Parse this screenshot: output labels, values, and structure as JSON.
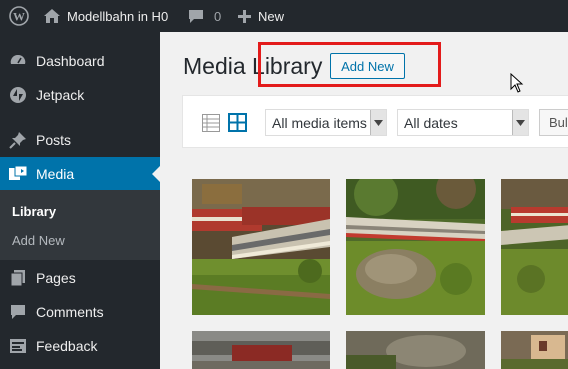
{
  "adminbar": {
    "site_name": "Modellbahn in H0",
    "comments_count": "0",
    "new_label": "New"
  },
  "sidebar": {
    "items": [
      {
        "label": "Dashboard",
        "icon": "dashboard-icon"
      },
      {
        "label": "Jetpack",
        "icon": "jetpack-icon"
      },
      {
        "label": "Posts",
        "icon": "pin-icon"
      },
      {
        "label": "Media",
        "icon": "media-icon"
      },
      {
        "label": "Pages",
        "icon": "pages-icon"
      },
      {
        "label": "Comments",
        "icon": "comment-icon"
      },
      {
        "label": "Feedback",
        "icon": "feedback-icon"
      }
    ],
    "submenu": [
      "Library",
      "Add New"
    ]
  },
  "main": {
    "title": "Media Library",
    "add_new_label": "Add New"
  },
  "toolbar": {
    "filter_media": "All media items",
    "filter_dates": "All dates",
    "bulk_label": "Bul"
  },
  "colors": {
    "adminbar_bg": "#23282d",
    "accent": "#0073aa",
    "highlight": "#e31b1b"
  }
}
